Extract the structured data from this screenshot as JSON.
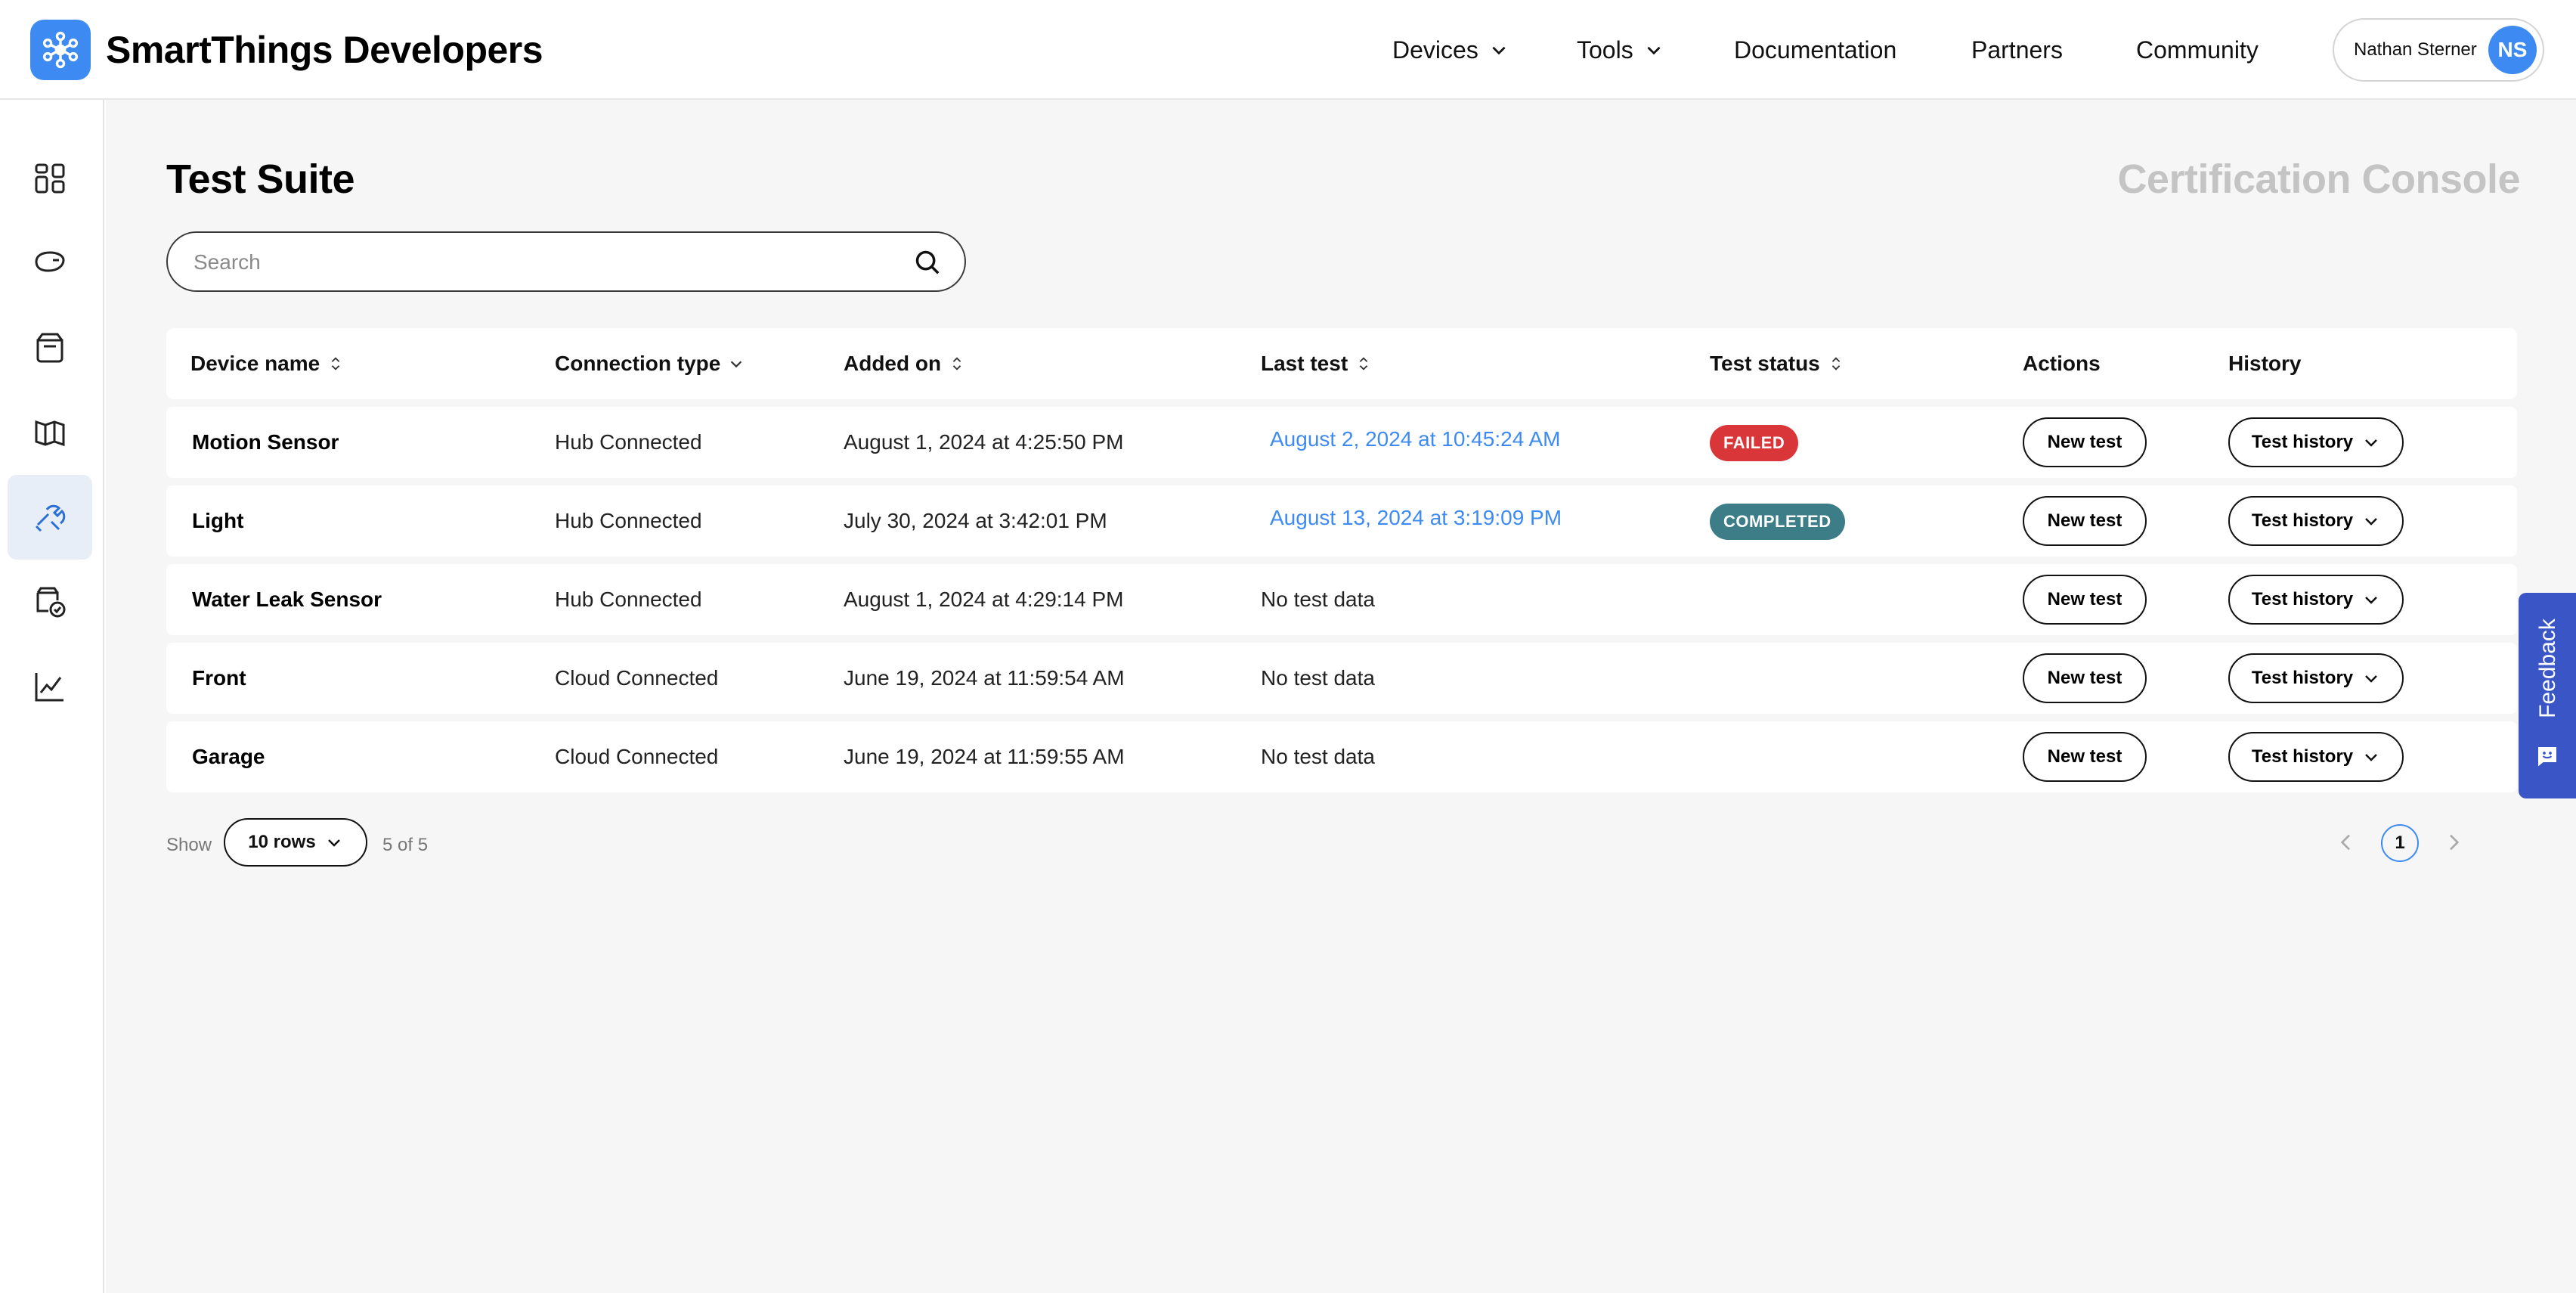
{
  "header": {
    "brand": "SmartThings Developers",
    "nav": [
      {
        "label": "Devices"
      },
      {
        "label": "Tools"
      },
      {
        "label": "Documentation"
      },
      {
        "label": "Partners"
      },
      {
        "label": "Community"
      }
    ],
    "user_name": "Nathan Sterner",
    "avatar_initials": "NS"
  },
  "sidebar": {
    "items": [
      {
        "icon": "dashboard-icon"
      },
      {
        "icon": "device-icon"
      },
      {
        "icon": "box-icon"
      },
      {
        "icon": "book-icon"
      },
      {
        "icon": "tools-icon",
        "active": true
      },
      {
        "icon": "certification-icon"
      },
      {
        "icon": "analytics-icon"
      }
    ]
  },
  "main": {
    "title": "Test Suite",
    "console_title": "Certification Console",
    "search_placeholder": "Search"
  },
  "table": {
    "columns": [
      "Device name",
      "Connection type",
      "Added on",
      "Last test",
      "Test status",
      "Actions",
      "History"
    ],
    "rows": [
      {
        "name": "Motion Sensor",
        "connection": "Hub Connected",
        "added": "August 1, 2024 at 4:25:50 PM",
        "last_test": "August 2, 2024 at 10:45:24 AM",
        "status": "FAILED",
        "action": "New test",
        "history": "Test history"
      },
      {
        "name": "Light",
        "connection": "Hub Connected",
        "added": "July 30, 2024 at 3:42:01 PM",
        "last_test": "August 13, 2024 at 3:19:09 PM",
        "status": "COMPLETED",
        "action": "New test",
        "history": "Test history"
      },
      {
        "name": "Water Leak Sensor",
        "connection": "Hub Connected",
        "added": "August 1, 2024 at 4:29:14 PM",
        "last_test": "No test data",
        "status": "",
        "action": "New test",
        "history": "Test history"
      },
      {
        "name": "Front",
        "connection": "Cloud Connected",
        "added": "June 19, 2024 at 11:59:54 AM",
        "last_test": "No test data",
        "status": "",
        "action": "New test",
        "history": "Test history"
      },
      {
        "name": "Garage",
        "connection": "Cloud Connected",
        "added": "June 19, 2024 at 11:59:55 AM",
        "last_test": "No test data",
        "status": "",
        "action": "New test",
        "history": "Test history"
      }
    ]
  },
  "footer": {
    "show_label": "Show",
    "rows_select": "10 rows",
    "count": "5 of 5",
    "page": "1"
  },
  "feedback": {
    "label": "Feedback"
  },
  "colors": {
    "accent": "#3d8bf2",
    "failed": "#d9363a",
    "completed": "#3c7d87",
    "feedback": "#3a56c6"
  }
}
